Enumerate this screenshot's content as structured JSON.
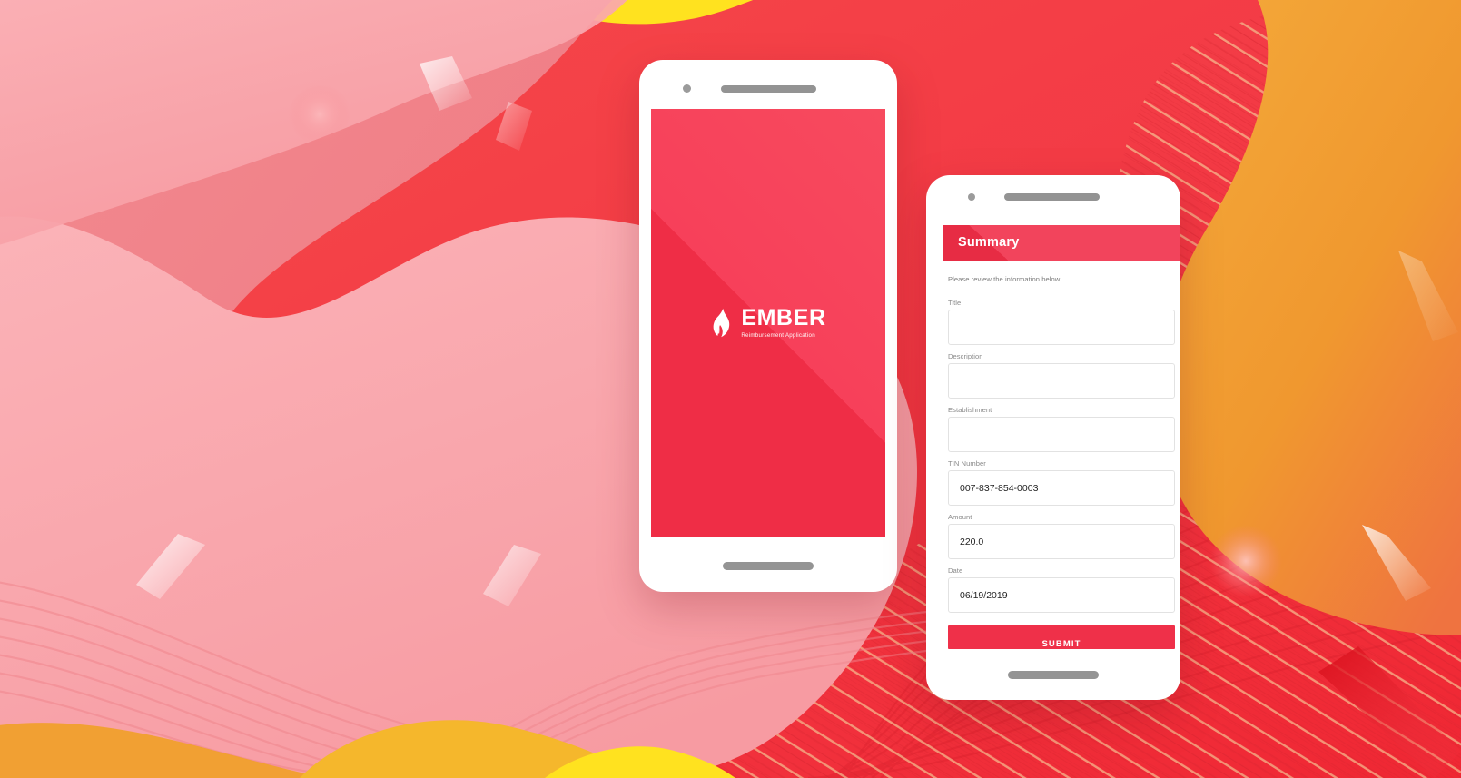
{
  "background": {
    "palette": {
      "yellow": "#ffe21f",
      "orange": "#f0a02c",
      "red": "#f43344",
      "red_dark": "#e01f2d",
      "pink_mid": "#ef7f86",
      "pink_light": "#f9aab0",
      "cream_line": "#f6cf9a"
    },
    "decor": [
      "wave-lines",
      "diagonal-stripes",
      "glow-circle",
      "shard-parallelogram"
    ]
  },
  "splash_phone": {
    "name": "Ember splash screen",
    "logo": {
      "icon": "flame-icon",
      "word": "EMBER",
      "tagline": "Reimbursement Application"
    },
    "screen_color": "#ef2d46",
    "hardware": {
      "camera": "camera-dot",
      "speaker": "speaker-grille",
      "home": "home-bar"
    }
  },
  "form_phone": {
    "appbar": {
      "title": "Summary",
      "color": "#ef3049"
    },
    "note": "Please review the information below:",
    "fields": [
      {
        "label": "Title",
        "value": ""
      },
      {
        "label": "Description",
        "value": ""
      },
      {
        "label": "Establishment",
        "value": ""
      },
      {
        "label": "TIN Number",
        "value": "007-837-854-0003"
      },
      {
        "label": "Amount",
        "value": "220.0"
      },
      {
        "label": "Date",
        "value": "06/19/2019"
      }
    ],
    "submit_label": "SUBMIT",
    "hardware": {
      "camera": "camera-dot",
      "speaker": "speaker-grille",
      "home": "home-bar"
    }
  }
}
